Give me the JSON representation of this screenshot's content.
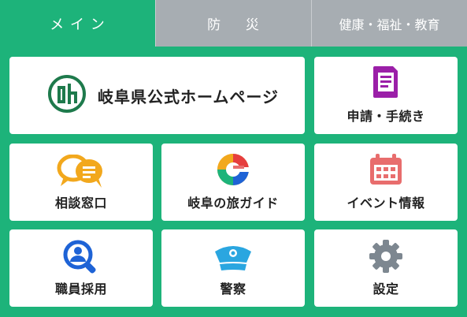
{
  "tabs": [
    {
      "label": "メ イ ン",
      "active": true
    },
    {
      "label": "防 　 災",
      "active": false
    },
    {
      "label": "健康・福祉・教育",
      "active": false
    }
  ],
  "colors": {
    "background": "#1db37a",
    "inactive_tab": "#a7adb2",
    "logo": "#1e7a4c",
    "application_icon": "#9b1fa8",
    "consultation_icon": "#f2a81d",
    "event_icon": "#e86d6d",
    "recruit_icon": "#1e63d6",
    "police_icon": "#2aa6e0",
    "settings_icon": "#7d8790"
  },
  "tiles": {
    "home": {
      "label": "岐阜県公式ホームページ",
      "icon": "gifu-prefecture-emblem-icon"
    },
    "application": {
      "label": "申請・手続き",
      "icon": "document-icon"
    },
    "consultation": {
      "label": "相談窓口",
      "icon": "chat-bubbles-icon"
    },
    "tourism": {
      "label": "岐阜の旅ガイド",
      "icon": "colorful-g-logo-icon"
    },
    "events": {
      "label": "イベント情報",
      "icon": "calendar-icon"
    },
    "recruitment": {
      "label": "職員採用",
      "icon": "person-search-icon"
    },
    "police": {
      "label": "警察",
      "icon": "police-badge-icon"
    },
    "settings": {
      "label": "設定",
      "icon": "gear-icon"
    }
  }
}
